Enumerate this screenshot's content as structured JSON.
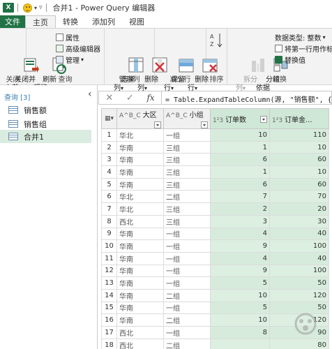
{
  "window": {
    "app_icon_label": "X",
    "title": "合并1 - Power Query 编辑器"
  },
  "tabs": [
    {
      "label": "文件"
    },
    {
      "label": "主页"
    },
    {
      "label": "转换"
    },
    {
      "label": "添加列"
    },
    {
      "label": "视图"
    }
  ],
  "ribbon": {
    "close_group": {
      "label": "关闭",
      "close_load": "关闭并\n上载"
    },
    "query_group": {
      "label": "查询",
      "refresh": "刷新\n预览",
      "properties": "属性",
      "advanced_editor": "高级编辑器",
      "manage": "管理"
    },
    "manage_columns_group": {
      "label": "管理列",
      "choose_columns": "选择\n列",
      "remove_columns": "删除\n列"
    },
    "reduce_rows_group": {
      "label": "减少行",
      "keep_rows": "保留\n行",
      "remove_rows": "删除\n行"
    },
    "sort_group": {
      "label": "排序"
    },
    "transform_group": {
      "label": "转换",
      "split_column": "拆分\n列",
      "group_by": "分组\n依据",
      "data_type": "数据类型: 整数",
      "use_first_row": "将第一行用作标",
      "replace_values": "替换值"
    }
  },
  "queries": {
    "header": "查询 [3]",
    "items": [
      {
        "label": "销售额"
      },
      {
        "label": "销售组"
      },
      {
        "label": "合并1"
      }
    ]
  },
  "formula_bar": {
    "cancel": "✕",
    "confirm": "✓",
    "fx": "fx",
    "formula": "= Table.ExpandTableColumn(源, \"销售额\", {\"订单"
  },
  "grid": {
    "columns": [
      {
        "type": "A^B_C",
        "name": "大区"
      },
      {
        "type": "A^B_C",
        "name": "小组"
      },
      {
        "type": "1²3",
        "name": "订单数"
      },
      {
        "type": "1²3",
        "name": "订单金..."
      }
    ],
    "rows": [
      {
        "n": "1",
        "region": "华北",
        "group": "一组",
        "orders": "10",
        "amount": "110"
      },
      {
        "n": "2",
        "region": "华南",
        "group": "三组",
        "orders": "1",
        "amount": "10"
      },
      {
        "n": "3",
        "region": "华南",
        "group": "三组",
        "orders": "6",
        "amount": "60"
      },
      {
        "n": "4",
        "region": "华南",
        "group": "三组",
        "orders": "1",
        "amount": "10"
      },
      {
        "n": "5",
        "region": "华南",
        "group": "三组",
        "orders": "6",
        "amount": "60"
      },
      {
        "n": "6",
        "region": "华北",
        "group": "二组",
        "orders": "7",
        "amount": "70"
      },
      {
        "n": "7",
        "region": "华北",
        "group": "三组",
        "orders": "2",
        "amount": "20"
      },
      {
        "n": "8",
        "region": "西北",
        "group": "三组",
        "orders": "3",
        "amount": "30"
      },
      {
        "n": "9",
        "region": "华南",
        "group": "一组",
        "orders": "4",
        "amount": "40"
      },
      {
        "n": "10",
        "region": "华南",
        "group": "一组",
        "orders": "9",
        "amount": "100"
      },
      {
        "n": "11",
        "region": "华南",
        "group": "一组",
        "orders": "4",
        "amount": "40"
      },
      {
        "n": "12",
        "region": "华南",
        "group": "一组",
        "orders": "9",
        "amount": "100"
      },
      {
        "n": "13",
        "region": "华南",
        "group": "一组",
        "orders": "5",
        "amount": "50"
      },
      {
        "n": "14",
        "region": "华南",
        "group": "二组",
        "orders": "10",
        "amount": "120"
      },
      {
        "n": "15",
        "region": "华南",
        "group": "一组",
        "orders": "5",
        "amount": "50"
      },
      {
        "n": "16",
        "region": "华南",
        "group": "二组",
        "orders": "10",
        "amount": "120"
      },
      {
        "n": "17",
        "region": "西北",
        "group": "一组",
        "orders": "8",
        "amount": "90"
      },
      {
        "n": "18",
        "region": "西北",
        "group": "二组",
        "orders": "",
        "amount": "80"
      }
    ]
  },
  "colors": {
    "excel_green": "#217346",
    "selected_column": "#dcefe1",
    "query_selected": "#d9ecdf"
  }
}
